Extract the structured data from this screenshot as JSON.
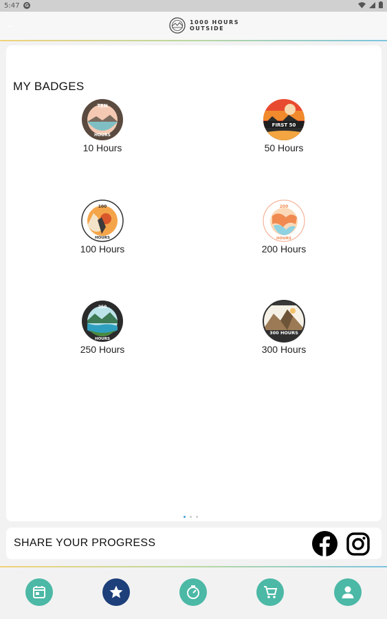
{
  "status_bar": {
    "time": "5:47"
  },
  "app_bar": {
    "logo_line1": "1000 HOURS",
    "logo_line2": "OUTSIDE"
  },
  "badges_section": {
    "title": "MY BADGES",
    "badges": [
      {
        "label": "10 Hours",
        "art": "TEN HOURS",
        "icon": "ten-hours-badge-icon"
      },
      {
        "label": "50 Hours",
        "art": "FIRST 50",
        "icon": "first-50-badge-icon"
      },
      {
        "label": "100 Hours",
        "art": "100 HOURS",
        "icon": "100-hours-badge-icon"
      },
      {
        "label": "200 Hours",
        "art": "200 HOURS",
        "icon": "200-hours-badge-icon"
      },
      {
        "label": "250 Hours",
        "art": "250 HOURS",
        "icon": "250-hours-badge-icon"
      },
      {
        "label": "300 Hours",
        "art": "300 HOURS",
        "icon": "300-hours-badge-icon"
      }
    ],
    "page_indicator": {
      "count": 3,
      "active": 1
    }
  },
  "share": {
    "label": "SHARE YOUR PROGRESS",
    "icons": [
      "facebook-icon",
      "instagram-icon"
    ]
  },
  "nav": {
    "items": [
      "calendar-icon",
      "star-icon",
      "timer-icon",
      "cart-icon",
      "profile-icon"
    ],
    "active": 2
  },
  "colors": {
    "teal": "#4cb8a6",
    "navy": "#1d3f7a",
    "indicator": "#3ba0e0"
  }
}
